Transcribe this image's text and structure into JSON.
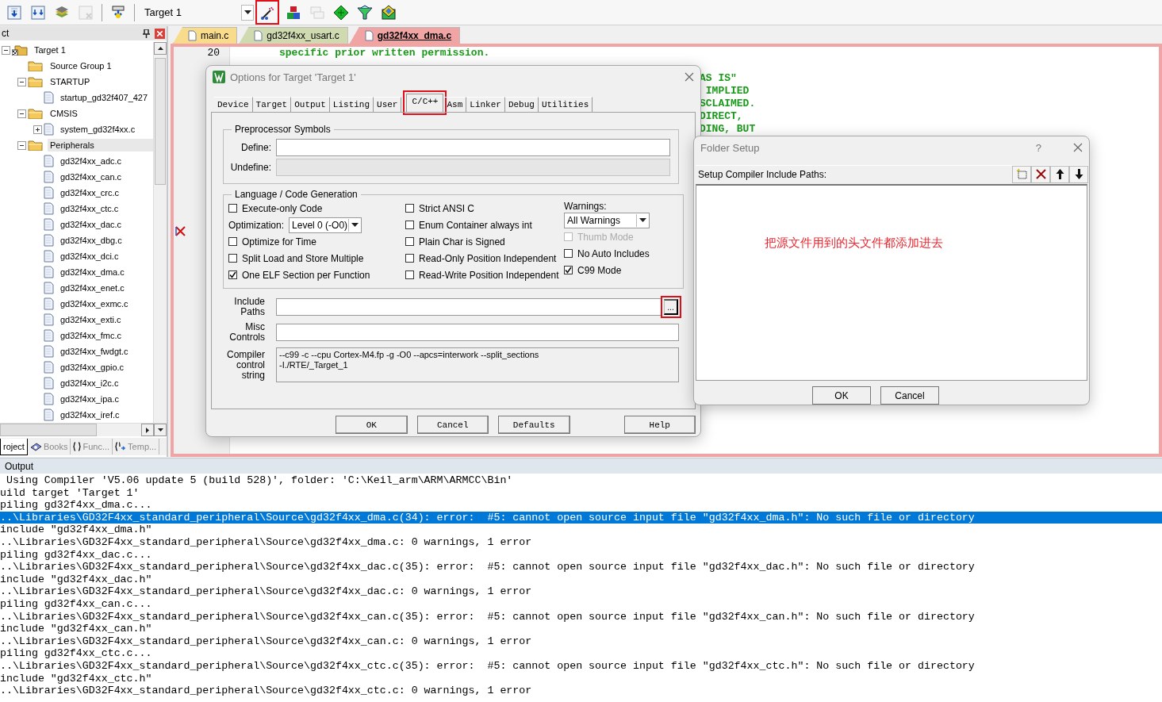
{
  "toolbar": {
    "build_tools": [
      {
        "kind": "doc-down",
        "disabled": false
      },
      {
        "kind": "doc-downs",
        "disabled": false
      },
      {
        "kind": "stack",
        "disabled": false
      },
      {
        "kind": "doc-x",
        "disabled": true
      }
    ],
    "download_tools": [
      {
        "kind": "load",
        "disabled": false
      }
    ],
    "target_select": {
      "value": "Target 1"
    },
    "setup_tools": [
      {
        "kind": "wand",
        "disabled": false,
        "marked": true
      },
      {
        "kind": "blocks",
        "disabled": false,
        "marked": false
      },
      {
        "kind": "windows",
        "disabled": true,
        "marked": false
      },
      {
        "kind": "diamond",
        "disabled": false,
        "marked": false
      },
      {
        "kind": "funnel",
        "disabled": false,
        "marked": false
      },
      {
        "kind": "pack",
        "disabled": false,
        "marked": false
      }
    ]
  },
  "project_panel": {
    "title": "ct",
    "tree": [
      {
        "label": "Target 1",
        "kind": "target",
        "expanded": true,
        "selected": false,
        "children": [
          {
            "label": "Source Group 1",
            "kind": "folder",
            "selected": false
          },
          {
            "label": "STARTUP",
            "kind": "folder",
            "expanded": true,
            "selected": false,
            "children": [
              {
                "label": "startup_gd32f407_427",
                "kind": "file",
                "selected": false
              }
            ]
          },
          {
            "label": "CMSIS",
            "kind": "folder",
            "expanded": true,
            "selected": false,
            "children": [
              {
                "label": "system_gd32f4xx.c",
                "kind": "file",
                "expanded": false,
                "selected": false
              }
            ]
          },
          {
            "label": "Peripherals",
            "kind": "folder",
            "expanded": true,
            "selected": true,
            "children": [
              {
                "label": "gd32f4xx_adc.c",
                "kind": "file",
                "selected": false
              },
              {
                "label": "gd32f4xx_can.c",
                "kind": "file",
                "selected": false
              },
              {
                "label": "gd32f4xx_crc.c",
                "kind": "file",
                "selected": false
              },
              {
                "label": "gd32f4xx_ctc.c",
                "kind": "file",
                "selected": false
              },
              {
                "label": "gd32f4xx_dac.c",
                "kind": "file",
                "selected": false
              },
              {
                "label": "gd32f4xx_dbg.c",
                "kind": "file",
                "selected": false
              },
              {
                "label": "gd32f4xx_dci.c",
                "kind": "file",
                "selected": false
              },
              {
                "label": "gd32f4xx_dma.c",
                "kind": "file",
                "selected": false
              },
              {
                "label": "gd32f4xx_enet.c",
                "kind": "file",
                "selected": false
              },
              {
                "label": "gd32f4xx_exmc.c",
                "kind": "file",
                "selected": false
              },
              {
                "label": "gd32f4xx_exti.c",
                "kind": "file",
                "selected": false
              },
              {
                "label": "gd32f4xx_fmc.c",
                "kind": "file",
                "selected": false
              },
              {
                "label": "gd32f4xx_fwdgt.c",
                "kind": "file",
                "selected": false
              },
              {
                "label": "gd32f4xx_gpio.c",
                "kind": "file",
                "selected": false
              },
              {
                "label": "gd32f4xx_i2c.c",
                "kind": "file",
                "selected": false
              },
              {
                "label": "gd32f4xx_ipa.c",
                "kind": "file",
                "selected": false
              },
              {
                "label": "gd32f4xx_iref.c",
                "kind": "file",
                "selected": false
              }
            ]
          }
        ]
      }
    ],
    "tabs": [
      {
        "label": "roject",
        "kind": "project",
        "selected": true
      },
      {
        "label": "Books",
        "kind": "books",
        "selected": false
      },
      {
        "label": "Func...",
        "kind": "functions",
        "selected": false
      },
      {
        "label": "Temp...",
        "kind": "templates",
        "selected": false
      }
    ]
  },
  "editor": {
    "tabs": [
      {
        "label": "main.c",
        "color": "#f8dc8c",
        "selected": false
      },
      {
        "label": "gd32f4xx_usart.c",
        "color": "#cfdab0",
        "selected": false
      },
      {
        "label": "gd32f4xx_dma.c",
        "color": "#f0a4a4",
        "selected": true
      }
    ],
    "line": {
      "number": "20",
      "text": "specific prior written permission."
    },
    "fragments": [
      "AS IS\"",
      " IMPLIED",
      "SCLAIMED.",
      "DIRECT,",
      "DING, BUT"
    ],
    "error_marker": true
  },
  "options_dialog": {
    "title": "Options for Target 'Target 1'",
    "tabs": [
      {
        "label": "Device",
        "selected": false,
        "marked": false
      },
      {
        "label": "Target",
        "selected": false,
        "marked": false
      },
      {
        "label": "Output",
        "selected": false,
        "marked": false
      },
      {
        "label": "Listing",
        "selected": false,
        "marked": false
      },
      {
        "label": "User",
        "selected": false,
        "marked": false
      },
      {
        "label": "C/C++",
        "selected": true,
        "marked": true
      },
      {
        "label": "Asm",
        "selected": false,
        "marked": false
      },
      {
        "label": "Linker",
        "selected": false,
        "marked": false
      },
      {
        "label": "Debug",
        "selected": false,
        "marked": false
      },
      {
        "label": "Utilities",
        "selected": false,
        "marked": false
      }
    ],
    "preprocessor": {
      "title": "Preprocessor Symbols",
      "fields": [
        {
          "label": "Define:",
          "disabled": false
        },
        {
          "label": "Undefine:",
          "disabled": true
        }
      ]
    },
    "language": {
      "title": "Language / Code Generation",
      "columns": [
        [
          {
            "kind": "checkbox",
            "label": "Execute-only Code",
            "checked": false,
            "disabled": false
          },
          {
            "kind": "select",
            "label": "Optimization:",
            "value": "Level 0 (-O0)"
          },
          {
            "kind": "checkbox",
            "label": "Optimize for Time",
            "checked": false,
            "disabled": false
          },
          {
            "kind": "checkbox",
            "label": "Split Load and Store Multiple",
            "checked": false,
            "disabled": false
          },
          {
            "kind": "checkbox",
            "label": "One ELF Section per Function",
            "checked": true,
            "disabled": false
          }
        ],
        [
          {
            "kind": "checkbox",
            "label": "Strict ANSI C",
            "checked": false,
            "disabled": false
          },
          {
            "kind": "checkbox",
            "label": "Enum Container always int",
            "checked": false,
            "disabled": false
          },
          {
            "kind": "checkbox",
            "label": "Plain Char is Signed",
            "checked": false,
            "disabled": false
          },
          {
            "kind": "checkbox",
            "label": "Read-Only Position Independent",
            "checked": false,
            "disabled": false
          },
          {
            "kind": "checkbox",
            "label": "Read-Write Position Independent",
            "checked": false,
            "disabled": false
          }
        ],
        [
          {
            "kind": "caption",
            "label": "Warnings:"
          },
          {
            "kind": "select",
            "value": "All Warnings"
          },
          {
            "kind": "checkbox",
            "label": "Thumb Mode",
            "checked": false,
            "disabled": true
          },
          {
            "kind": "checkbox",
            "label": "No Auto Includes",
            "checked": false,
            "disabled": false
          },
          {
            "kind": "checkbox",
            "label": "C99 Mode",
            "checked": true,
            "disabled": false
          }
        ]
      ]
    },
    "include_paths": {
      "label": "Include Paths",
      "browse": "...",
      "marked": true
    },
    "misc_controls": {
      "label": "Misc Controls"
    },
    "compiler_string": {
      "label": "Compiler control string",
      "lines": [
        "--c99 -c --cpu Cortex-M4.fp -g -O0 --apcs=interwork --split_sections",
        "-I./RTE/_Target_1"
      ]
    },
    "buttons": [
      "OK",
      "Cancel",
      "Defaults",
      "Help"
    ]
  },
  "folder_dialog": {
    "title": "Folder Setup",
    "help": "?",
    "label": "Setup Compiler Include Paths:",
    "tools": [
      {
        "kind": "new"
      },
      {
        "kind": "delete"
      },
      {
        "kind": "up"
      },
      {
        "kind": "down"
      }
    ],
    "note": "把源文件用到的头文件都添加进去",
    "buttons": [
      "OK",
      "Cancel"
    ]
  },
  "output": {
    "title": "Output",
    "lines": [
      {
        "text": " Using Compiler 'V5.06 update 5 (build 528)', folder: 'C:\\Keil_arm\\ARM\\ARMCC\\Bin'",
        "selected": false
      },
      {
        "text": "uild target 'Target 1'",
        "selected": false
      },
      {
        "text": "piling gd32f4xx_dma.c...",
        "selected": false
      },
      {
        "text": "..\\Libraries\\GD32F4xx_standard_peripheral\\Source\\gd32f4xx_dma.c(34): error:  #5: cannot open source input file \"gd32f4xx_dma.h\": No such file or directory",
        "selected": true
      },
      {
        "text": "include \"gd32f4xx_dma.h\"",
        "selected": false
      },
      {
        "text": "..\\Libraries\\GD32F4xx_standard_peripheral\\Source\\gd32f4xx_dma.c: 0 warnings, 1 error",
        "selected": false
      },
      {
        "text": "piling gd32f4xx_dac.c...",
        "selected": false
      },
      {
        "text": "..\\Libraries\\GD32F4xx_standard_peripheral\\Source\\gd32f4xx_dac.c(35): error:  #5: cannot open source input file \"gd32f4xx_dac.h\": No such file or directory",
        "selected": false
      },
      {
        "text": "include \"gd32f4xx_dac.h\"",
        "selected": false
      },
      {
        "text": "..\\Libraries\\GD32F4xx_standard_peripheral\\Source\\gd32f4xx_dac.c: 0 warnings, 1 error",
        "selected": false
      },
      {
        "text": "piling gd32f4xx_can.c...",
        "selected": false
      },
      {
        "text": "..\\Libraries\\GD32F4xx_standard_peripheral\\Source\\gd32f4xx_can.c(35): error:  #5: cannot open source input file \"gd32f4xx_can.h\": No such file or directory",
        "selected": false
      },
      {
        "text": "include \"gd32f4xx_can.h\"",
        "selected": false
      },
      {
        "text": "..\\Libraries\\GD32F4xx_standard_peripheral\\Source\\gd32f4xx_can.c: 0 warnings, 1 error",
        "selected": false
      },
      {
        "text": "piling gd32f4xx_ctc.c...",
        "selected": false
      },
      {
        "text": "..\\Libraries\\GD32F4xx_standard_peripheral\\Source\\gd32f4xx_ctc.c(35): error:  #5: cannot open source input file \"gd32f4xx_ctc.h\": No such file or directory",
        "selected": false
      },
      {
        "text": "include \"gd32f4xx_ctc.h\"",
        "selected": false
      },
      {
        "text": "..\\Libraries\\GD32F4xx_standard_peripheral\\Source\\gd32f4xx_ctc.c: 0 warnings, 1 error",
        "selected": false
      }
    ]
  }
}
